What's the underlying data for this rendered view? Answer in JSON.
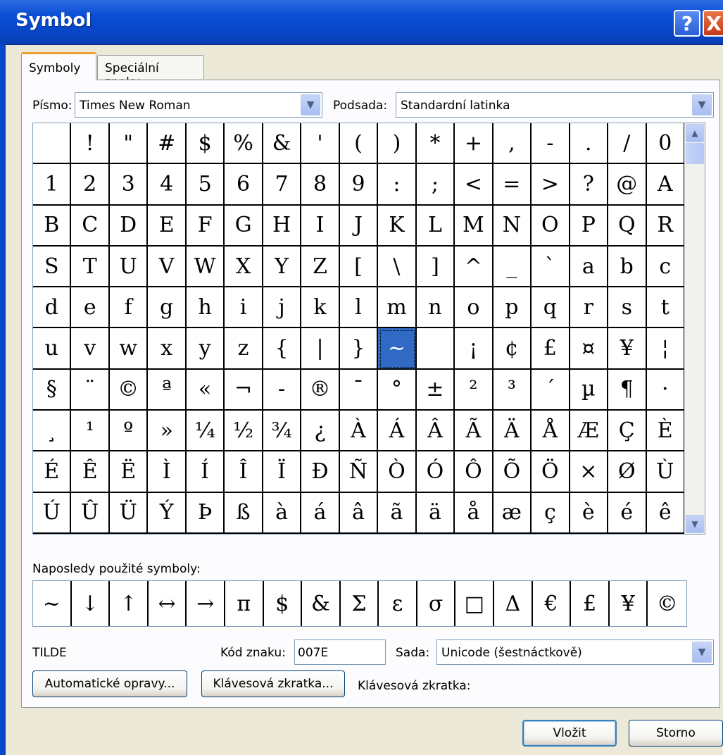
{
  "window": {
    "title": "Symbol",
    "help": "?",
    "close": "X"
  },
  "tabs": [
    {
      "label": "Symboly",
      "active": true
    },
    {
      "label": "Speciální znaky",
      "active": false
    }
  ],
  "font": {
    "label": "Písmo:",
    "value": "Times New Roman"
  },
  "subset": {
    "label": "Podsada:",
    "value": "Standardní latinka"
  },
  "grid": {
    "rows": [
      [
        "",
        "!",
        "\"",
        "#",
        "$",
        "%",
        "&",
        "'",
        "(",
        ")",
        "*",
        "+",
        ",",
        "-",
        ".",
        "/",
        "0"
      ],
      [
        "1",
        "2",
        "3",
        "4",
        "5",
        "6",
        "7",
        "8",
        "9",
        ":",
        ";",
        "<",
        "=",
        ">",
        "?",
        "@",
        "A"
      ],
      [
        "B",
        "C",
        "D",
        "E",
        "F",
        "G",
        "H",
        "I",
        "J",
        "K",
        "L",
        "M",
        "N",
        "O",
        "P",
        "Q",
        "R"
      ],
      [
        "S",
        "T",
        "U",
        "V",
        "W",
        "X",
        "Y",
        "Z",
        "[",
        "\\",
        "]",
        "^",
        "_",
        "`",
        "a",
        "b",
        "c"
      ],
      [
        "d",
        "e",
        "f",
        "g",
        "h",
        "i",
        "j",
        "k",
        "l",
        "m",
        "n",
        "o",
        "p",
        "q",
        "r",
        "s",
        "t"
      ],
      [
        "u",
        "v",
        "w",
        "x",
        "y",
        "z",
        "{",
        "|",
        "}",
        "~",
        "",
        "¡",
        "¢",
        "£",
        "¤",
        "¥",
        "¦"
      ],
      [
        "§",
        "¨",
        "©",
        "ª",
        "«",
        "¬",
        "-",
        "®",
        "¯",
        "°",
        "±",
        "²",
        "³",
        "´",
        "µ",
        "¶",
        "·"
      ],
      [
        "¸",
        "¹",
        "º",
        "»",
        "¼",
        "½",
        "¾",
        "¿",
        "À",
        "Á",
        "Â",
        "Ã",
        "Ä",
        "Å",
        "Æ",
        "Ç",
        "È"
      ],
      [
        "É",
        "Ê",
        "Ë",
        "Ì",
        "Í",
        "Î",
        "Ï",
        "Ð",
        "Ñ",
        "Ò",
        "Ó",
        "Ô",
        "Õ",
        "Ö",
        "×",
        "Ø",
        "Ù"
      ],
      [
        "Ú",
        "Û",
        "Ü",
        "Ý",
        "Þ",
        "ß",
        "à",
        "á",
        "â",
        "ã",
        "ä",
        "å",
        "æ",
        "ç",
        "è",
        "é",
        "ê"
      ]
    ],
    "selected": {
      "row": 5,
      "col": 9
    }
  },
  "recent": {
    "label": "Naposledy použité symboly:",
    "symbols": [
      "~",
      "↓",
      "↑",
      "↔",
      "→",
      "π",
      "$",
      "&",
      "Σ",
      "ε",
      "σ",
      "□",
      "Δ",
      "€",
      "£",
      "¥",
      "©"
    ]
  },
  "char_name": "TILDE",
  "char_code": {
    "label": "Kód znaku:",
    "value": "007E"
  },
  "charset": {
    "label": "Sada:",
    "value": "Unicode (šestnáctkově)"
  },
  "buttons": {
    "autocorrect": "Automatické opravy...",
    "shortcut_key": "Klávesová zkratka...",
    "shortcut_label": "Klávesová zkratka:",
    "insert": "Vložit",
    "cancel": "Storno"
  },
  "colors": {
    "selection": "#316ac5",
    "titlebar": "#0a4fd6"
  }
}
